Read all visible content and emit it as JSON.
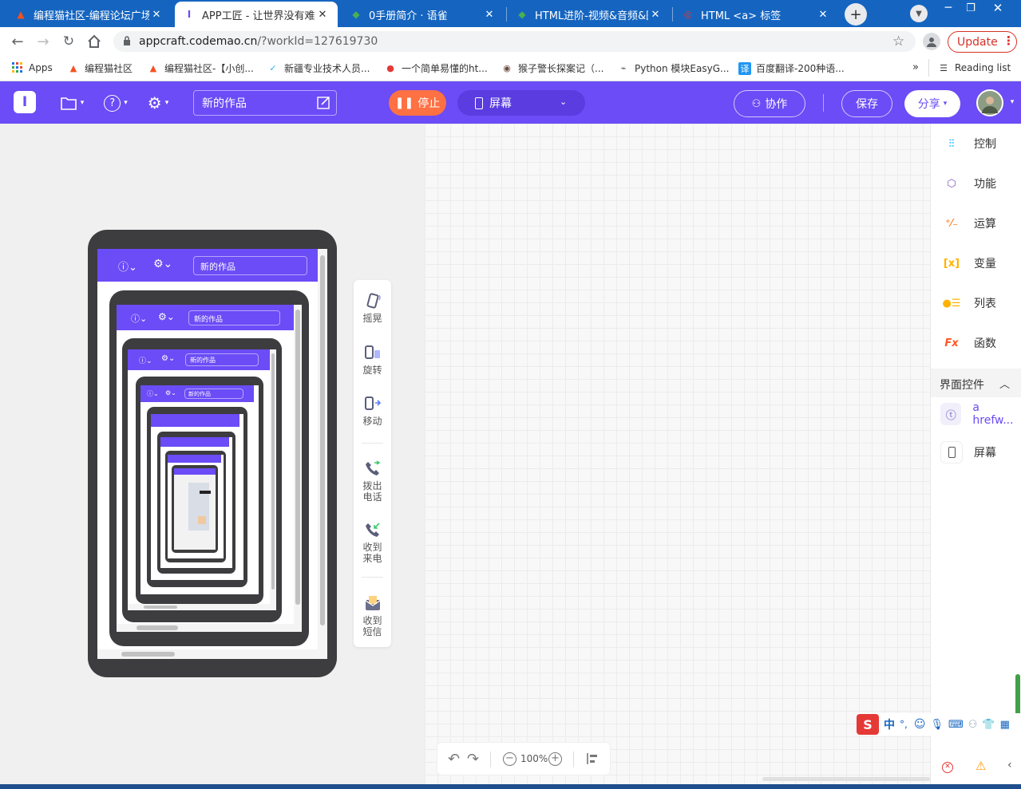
{
  "browser": {
    "tabs": [
      {
        "title": "编程猫社区-编程论坛广场-",
        "active": false
      },
      {
        "title": "APP工匠 - 让世界没有难做",
        "active": true
      },
      {
        "title": "0手册简介 · 语雀",
        "active": false
      },
      {
        "title": "HTML进阶-视频&音频&图",
        "active": false
      },
      {
        "title": "HTML <a> 标签",
        "active": false
      }
    ],
    "url_host": "appcraft.codemao.cn",
    "url_path": "/?workId=127619730",
    "update_label": "Update",
    "bookmarks": [
      {
        "label": "Apps",
        "icon": "apps-grid-icon"
      },
      {
        "label": "编程猫社区",
        "icon": "codemao-icon"
      },
      {
        "label": "编程猫社区-【小创...",
        "icon": "codemao-icon"
      },
      {
        "label": "新疆专业技术人员...",
        "icon": "swoosh-icon"
      },
      {
        "label": "一个简单易懂的ht...",
        "icon": "pin-icon"
      },
      {
        "label": "猴子警长探案记（...",
        "icon": "monkey-icon"
      },
      {
        "label": "Python 模块EasyG...",
        "icon": "python-icon"
      },
      {
        "label": "百度翻译-200种语...",
        "icon": "translate-icon"
      }
    ],
    "reading_list": "Reading list"
  },
  "app": {
    "work_name": "新的作品",
    "stop_label": "停止",
    "screen_select": "屏幕",
    "collab_label": "协作",
    "save_label": "保存",
    "share_label": "分享",
    "brand_color": "#6b4cf6",
    "stop_color": "#ff7043"
  },
  "sensors": [
    {
      "label": "摇晃",
      "icon": "shake-icon"
    },
    {
      "label": "旋转",
      "icon": "rotate-icon"
    },
    {
      "label": "移动",
      "icon": "move-icon"
    },
    {
      "label": "拨出电话",
      "icon": "outgoing-call-icon"
    },
    {
      "label": "收到来电",
      "icon": "incoming-call-icon"
    },
    {
      "label": "收到短信",
      "icon": "sms-icon"
    }
  ],
  "palette": {
    "categories": [
      {
        "label": "控制",
        "icon": "control-icon",
        "color": "#29b6f6"
      },
      {
        "label": "功能",
        "icon": "function-icon",
        "color": "#7e57c2"
      },
      {
        "label": "运算",
        "icon": "operator-icon",
        "color": "#ff8a3d"
      },
      {
        "label": "变量",
        "icon": "variable-icon",
        "color": "#ffb300"
      },
      {
        "label": "列表",
        "icon": "list-icon",
        "color": "#ffb300"
      },
      {
        "label": "函数",
        "icon": "fx-icon",
        "color": "#ff5722"
      }
    ],
    "section_title": "界面控件",
    "widgets": [
      {
        "label": "a hrefw...",
        "icon": "text-widget-icon"
      },
      {
        "label": "屏幕",
        "icon": "screen-widget-icon"
      }
    ]
  },
  "toolbar": {
    "zoom": "100%"
  },
  "ime": {
    "mode": "中"
  }
}
